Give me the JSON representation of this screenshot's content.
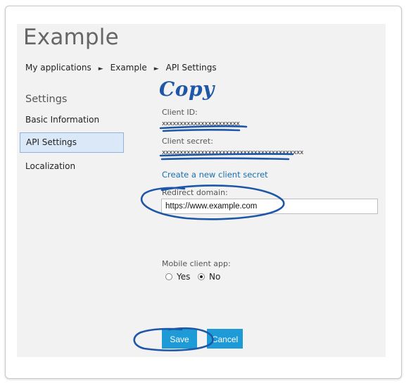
{
  "page": {
    "title": "Example"
  },
  "breadcrumb": {
    "items": [
      "My applications",
      "Example",
      "API Settings"
    ],
    "separator": "►"
  },
  "sidebar": {
    "heading": "Settings",
    "items": [
      {
        "label": "Basic Information",
        "active": false
      },
      {
        "label": "API Settings",
        "active": true
      },
      {
        "label": "Localization",
        "active": false
      }
    ]
  },
  "annotation": {
    "copy_text": "Copy",
    "ink_color": "#1e56a8"
  },
  "api": {
    "client_id_label": "Client ID:",
    "client_id_value": "xxxxxxxxxxxxxxxxxxxxxx",
    "client_secret_label": "Client secret:",
    "client_secret_value": "xxxxxxxxxxxxxxxxxxxxxxxxxxxxxxxxxxxxxxxx",
    "new_secret_link": "Create a new client secret",
    "redirect_label": "Redirect domain:",
    "redirect_value": "https://www.example.com",
    "mobile_label": "Mobile client app:",
    "mobile_options": [
      {
        "label": "Yes",
        "checked": false
      },
      {
        "label": "No",
        "checked": true
      }
    ]
  },
  "actions": {
    "save_label": "Save",
    "cancel_label": "Cancel",
    "button_color": "#1e9bd7"
  }
}
